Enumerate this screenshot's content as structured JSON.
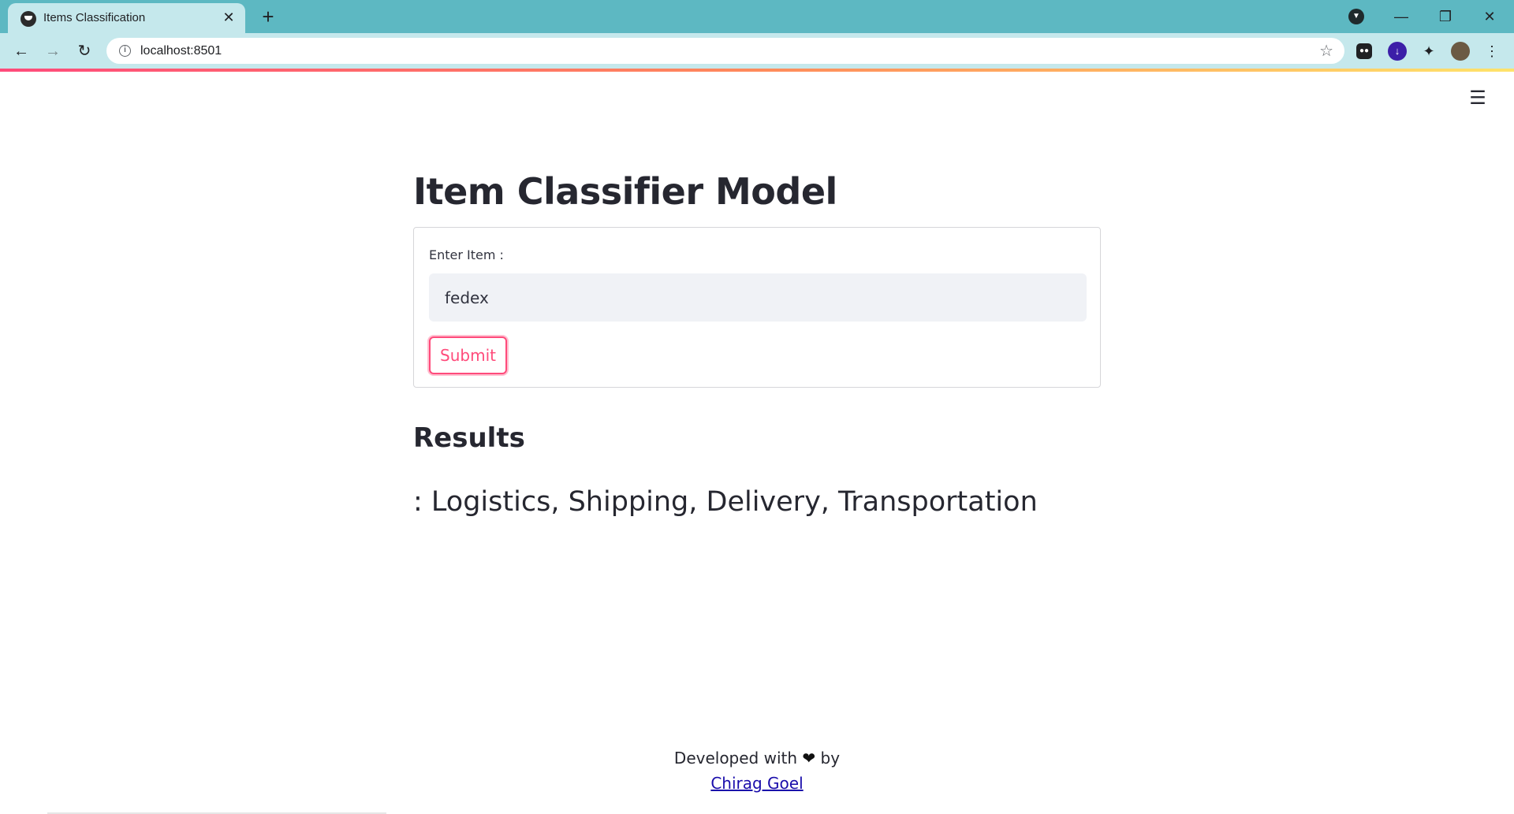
{
  "browser": {
    "tab_title": "Items Classification",
    "tab_close": "✕",
    "new_tab": "+",
    "url": "localhost:8501",
    "nav": {
      "back": "←",
      "forward": "→",
      "reload": "↻"
    },
    "window": {
      "minimize": "—",
      "restore": "❐",
      "close": "✕"
    },
    "star": "☆"
  },
  "app": {
    "menu_glyph": "☰",
    "title": "Item Classifier Model",
    "form": {
      "label": "Enter Item :",
      "value": "fedex",
      "submit_label": "Submit"
    },
    "results": {
      "heading": "Results",
      "value": ": Logistics, Shipping, Delivery, Transportation"
    },
    "footer": {
      "prefix": "Developed with",
      "heart": "❤",
      "suffix": "by",
      "author": "Chirag Goel"
    }
  },
  "colors": {
    "accent": "#ff4b7b",
    "tabbar": "#5db8c2",
    "toolbar": "#c5e8ec",
    "text": "#262730",
    "input_bg": "#f0f2f6"
  }
}
